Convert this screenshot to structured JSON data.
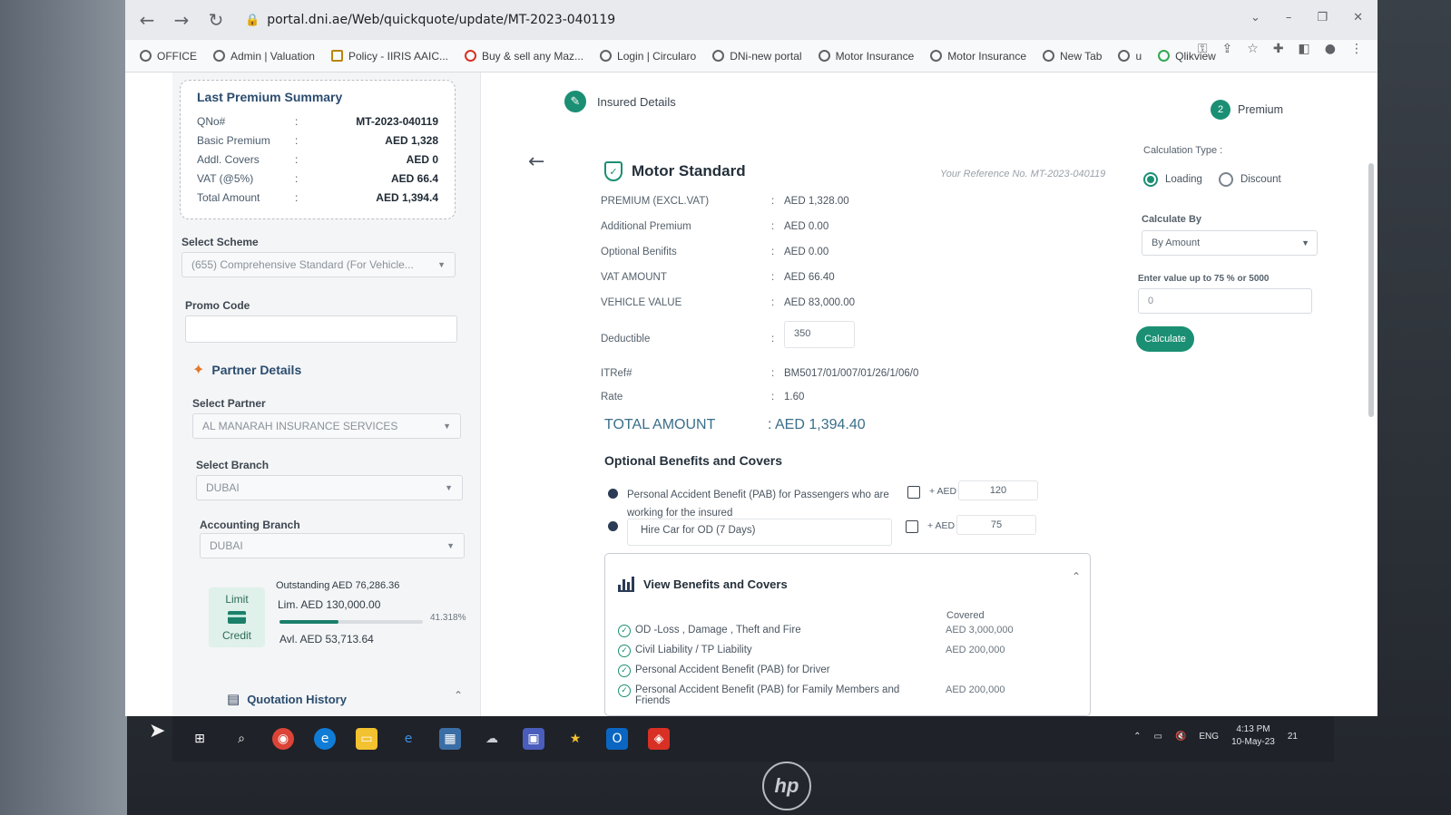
{
  "browser": {
    "url": "portal.dni.ae/Web/quickquote/update/MT-2023-040119",
    "bookmarks": [
      {
        "label": "OFFICE"
      },
      {
        "label": "Admin | Valuation"
      },
      {
        "label": "Policy - IIRIS AAIC..."
      },
      {
        "label": "Buy & sell any Maz..."
      },
      {
        "label": "Login | Circularo"
      },
      {
        "label": "DNi-new portal"
      },
      {
        "label": "Motor Insurance"
      },
      {
        "label": "Motor Insurance"
      },
      {
        "label": "New Tab"
      },
      {
        "label": "u"
      },
      {
        "label": "Qlikview"
      }
    ]
  },
  "summary": {
    "title": "Last Premium Summary",
    "rows": [
      {
        "label": "QNo#",
        "value": "MT-2023-040119"
      },
      {
        "label": "Basic Premium",
        "value": "AED 1,328"
      },
      {
        "label": "Addl. Covers",
        "value": "AED 0"
      },
      {
        "label": "VAT (@5%)",
        "value": "AED 66.4"
      },
      {
        "label": "Total Amount",
        "value": "AED 1,394.4"
      }
    ]
  },
  "left": {
    "scheme_label": "Select Scheme",
    "scheme_value": "(655) Comprehensive Standard (For Vehicle...",
    "promo_label": "Promo Code",
    "promo_value": "",
    "partner_title": "Partner Details",
    "partner_label": "Select Partner",
    "partner_value": "AL MANARAH INSURANCE SERVICES",
    "branch_label": "Select Branch",
    "branch_value": "DUBAI",
    "acc_branch_label": "Accounting Branch",
    "acc_branch_value": "DUBAI",
    "limit_label": "Limit",
    "credit_label": "Credit",
    "outstanding": "Outstanding AED 76,286.36",
    "limit_amount": "Lim. AED 130,000.00",
    "available": "Avl. AED 53,713.64",
    "percent": "41.318%",
    "progress_fraction": 0.41318,
    "history_title": "Quotation History"
  },
  "center": {
    "step1": "Insured Details",
    "product": "Motor Standard",
    "reference": "Your Reference No. MT-2023-040119",
    "details": [
      {
        "label": "PREMIUM (EXCL.VAT)",
        "value": "AED 1,328.00"
      },
      {
        "label": "Additional Premium",
        "value": "AED 0.00"
      },
      {
        "label": "Optional Benifits",
        "value": "AED 0.00"
      },
      {
        "label": "VAT AMOUNT",
        "value": "AED 66.40"
      },
      {
        "label": "VEHICLE VALUE",
        "value": "AED 83,000.00"
      }
    ],
    "deductible_label": "Deductible",
    "deductible_value": "350",
    "itref_label": "ITRef#",
    "itref_value": "BM5017/01/007/01/26/1/06/0",
    "rate_label": "Rate",
    "rate_value": "1.60",
    "total_label": "TOTAL AMOUNT",
    "total_value": ": AED 1,394.40",
    "optional_title": "Optional Benefits and Covers",
    "optional": [
      {
        "line1": "Personal Accident Benefit (PAB) for Passengers who are",
        "line2": "working for the insured",
        "aed": "+ AED",
        "amount": "120"
      },
      {
        "line1": "Hire Car for OD (7 Days)",
        "aed": "+ AED",
        "amount": "75"
      }
    ],
    "benefits_title": "View Benefits and Covers",
    "covered_header": "Covered",
    "benefits": [
      {
        "name": "OD -Loss , Damage , Theft and Fire",
        "value": "AED 3,000,000"
      },
      {
        "name": "Civil Liability / TP Liability",
        "value": "AED 200,000"
      },
      {
        "name": "Personal Accident Benefit (PAB) for Driver",
        "value": ""
      },
      {
        "name": "Personal Accident Benefit (PAB) for Family Members and Friends",
        "value": "AED 200,000"
      }
    ]
  },
  "right": {
    "step_num": "2",
    "step2": "Premium",
    "calc_type_label": "Calculation Type :",
    "radio_loading": "Loading",
    "radio_discount": "Discount",
    "selected_type": "Loading",
    "calc_by_label": "Calculate By",
    "calc_by_value": "By Amount",
    "enter_label": "Enter value up to 75 % or 5000",
    "enter_value": "0",
    "calc_button": "Calculate"
  },
  "taskbar": {
    "lang": "ENG",
    "time": "4:13 PM",
    "date": "10-May-23",
    "notif": "21"
  },
  "monitor_brand": "hp"
}
